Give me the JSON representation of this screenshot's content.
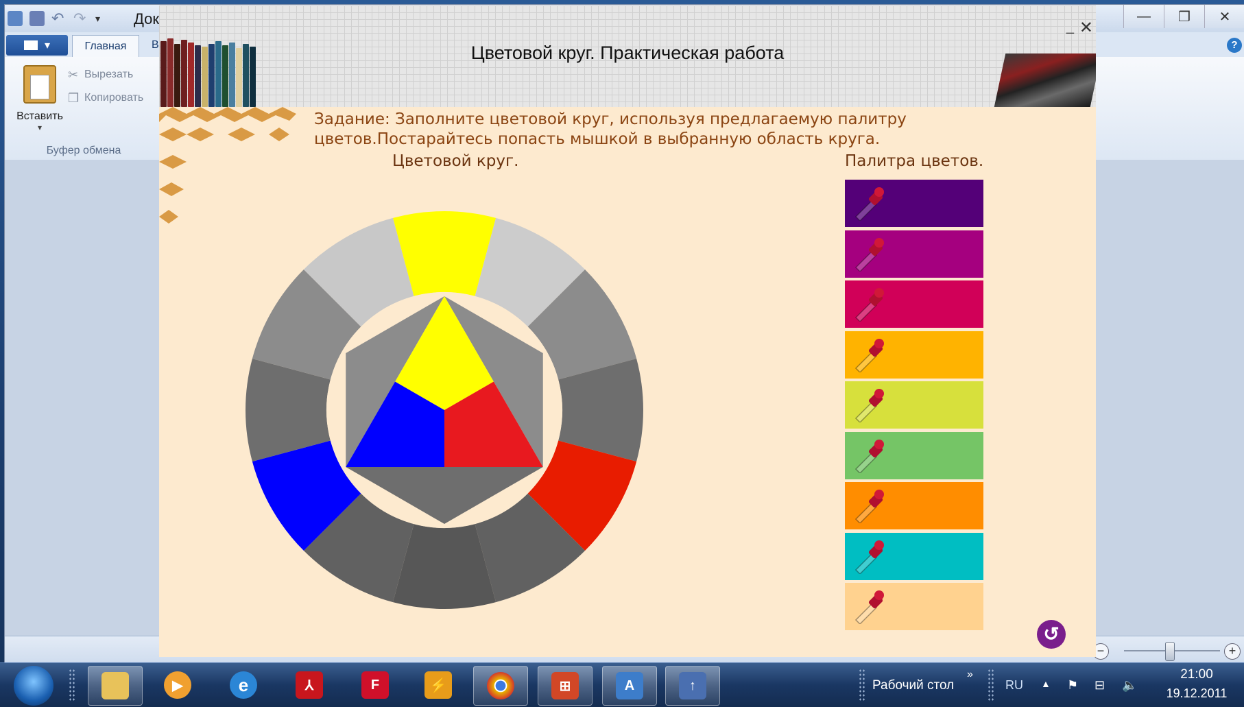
{
  "wordpad": {
    "title": "Док",
    "tabs": {
      "file": "▾",
      "home": "Главная",
      "view": "В"
    },
    "ribbon": {
      "paste": "Вставить",
      "cut": "Вырезать",
      "copy": "Копировать",
      "group": "Буфер обмена"
    },
    "controls": {
      "minimize": "—",
      "restore": "❐",
      "close": "✕"
    },
    "zoom": {
      "minus": "−",
      "plus": "+"
    }
  },
  "app": {
    "title": "Цветовой круг. Практическая работа",
    "close": "✕",
    "minimize": "_",
    "task": "Задание: Заполните цветовой круг, используя предлагаемую палитру цветов.Постарайтесь попасть мышкой в выбранную область круга.",
    "wheel_label": "Цветовой круг.",
    "palette_label": "Палитра цветов.",
    "reset": "↺",
    "wheel": {
      "center_colors": {
        "yellow": "#ffff00",
        "blue": "#0000ff",
        "red": "#e8191f"
      },
      "outer_segments": [
        "#ffff00",
        "#cccccc",
        "#8c8c8c",
        "#6e6e6e",
        "#e81c00",
        "#616161",
        "#575757",
        "#616161",
        "#0000ff",
        "#6e6e6e",
        "#8c8c8c",
        "#c8c8c8"
      ],
      "hexagon_colors": {
        "top_left": "#8c8c8c",
        "top_right": "#8c8c8c",
        "bottom": "#6e6e6e"
      }
    },
    "palette": [
      {
        "name": "swatch-violet",
        "color": "#540078"
      },
      {
        "name": "swatch-purple",
        "color": "#a5007f"
      },
      {
        "name": "swatch-crimson",
        "color": "#d10058"
      },
      {
        "name": "swatch-amber",
        "color": "#ffb300"
      },
      {
        "name": "swatch-lime",
        "color": "#d7e03c"
      },
      {
        "name": "swatch-green",
        "color": "#75c566"
      },
      {
        "name": "swatch-orange",
        "color": "#ff8d00"
      },
      {
        "name": "swatch-teal",
        "color": "#00bec2"
      },
      {
        "name": "swatch-peach",
        "color": "#ffd28f"
      }
    ]
  },
  "taskbar": {
    "desktop_label": "Рабочий стол",
    "chevron": "»",
    "language": "RU",
    "tray_up": "▲",
    "time": "21:00",
    "date": "19.12.2011"
  }
}
